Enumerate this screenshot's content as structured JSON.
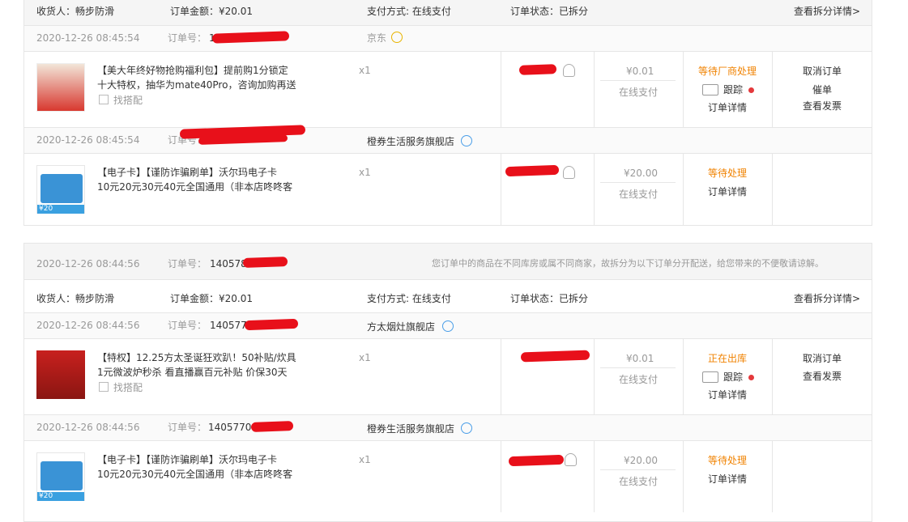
{
  "groups": [
    {
      "summary": {
        "consignee": "收货人：畅步防滑",
        "amount": "订单金额：¥20.01",
        "payment": "支付方式: 在线支付",
        "status": "订单状态：已拆分",
        "detail_link": "查看拆分详情>"
      },
      "suborders": [
        {
          "time": "2020-12-26 08:45:54",
          "order_no_label": "订单号：",
          "order_no": "14",
          "shop": "京东",
          "item_title_1": "【美大年终好物抢购福利包】提前购1分锁定",
          "item_title_2": "十大特权，抽华为mate40Pro，咨询加购再送",
          "match": "找搭配",
          "qty": "x1",
          "price": "¥0.01",
          "pay": "在线支付",
          "status": "等待厂商处理",
          "track": "跟踪",
          "detail": "订单详情",
          "actions": [
            "取消订单",
            "催单",
            "查看发票"
          ]
        },
        {
          "time": "2020-12-26 08:45:54",
          "order_no_label": "订单号：",
          "order_no": "",
          "shop": "橙券生活服务旗舰店",
          "item_title_1": "【电子卡】【谨防诈骗刷单】沃尔玛电子卡",
          "item_title_2": "10元20元30元40元全国通用（非本店咚咚客",
          "qty": "x1",
          "price": "¥20.00",
          "pay": "在线支付",
          "status": "等待处理",
          "detail": "订单详情",
          "thumb_price": "¥20"
        }
      ]
    },
    {
      "header": {
        "time": "2020-12-26 08:44:56",
        "order_no_label": "订单号：",
        "order_no": "1405789",
        "notice": "您订单中的商品在不同库房或属不同商家，故拆分为以下订单分开配送，给您带来的不便敬请谅解。"
      },
      "summary": {
        "consignee": "收货人：畅步防滑",
        "amount": "订单金额：¥20.01",
        "payment": "支付方式: 在线支付",
        "status": "订单状态：已拆分",
        "detail_link": "查看拆分详情>"
      },
      "suborders": [
        {
          "time": "2020-12-26 08:44:56",
          "order_no_label": "订单号：",
          "order_no": "140577",
          "shop": "方太烟灶旗舰店",
          "item_title_1": "【特权】12.25方太圣诞狂欢趴！50补贴/炊具",
          "item_title_2": "1元微波炉秒杀 看直播赢百元补贴 价保30天",
          "match": "找搭配",
          "qty": "x1",
          "price": "¥0.01",
          "pay": "在线支付",
          "status": "正在出库",
          "track": "跟踪",
          "detail": "订单详情",
          "actions": [
            "取消订单",
            "查看发票"
          ]
        },
        {
          "time": "2020-12-26 08:44:56",
          "order_no_label": "订单号：",
          "order_no": "1405770",
          "shop": "橙券生活服务旗舰店",
          "item_title_1": "【电子卡】【谨防诈骗刷单】沃尔玛电子卡",
          "item_title_2": "10元20元30元40元全国通用（非本店咚咚客",
          "qty": "x1",
          "price": "¥20.00",
          "pay": "在线支付",
          "status": "等待处理",
          "detail": "订单详情",
          "thumb_price": "¥20"
        }
      ]
    }
  ],
  "colors": {
    "accent_red": "#e4393c",
    "amber": "#f08200",
    "border": "#e6e6e6",
    "redaction": "#e8101a"
  }
}
